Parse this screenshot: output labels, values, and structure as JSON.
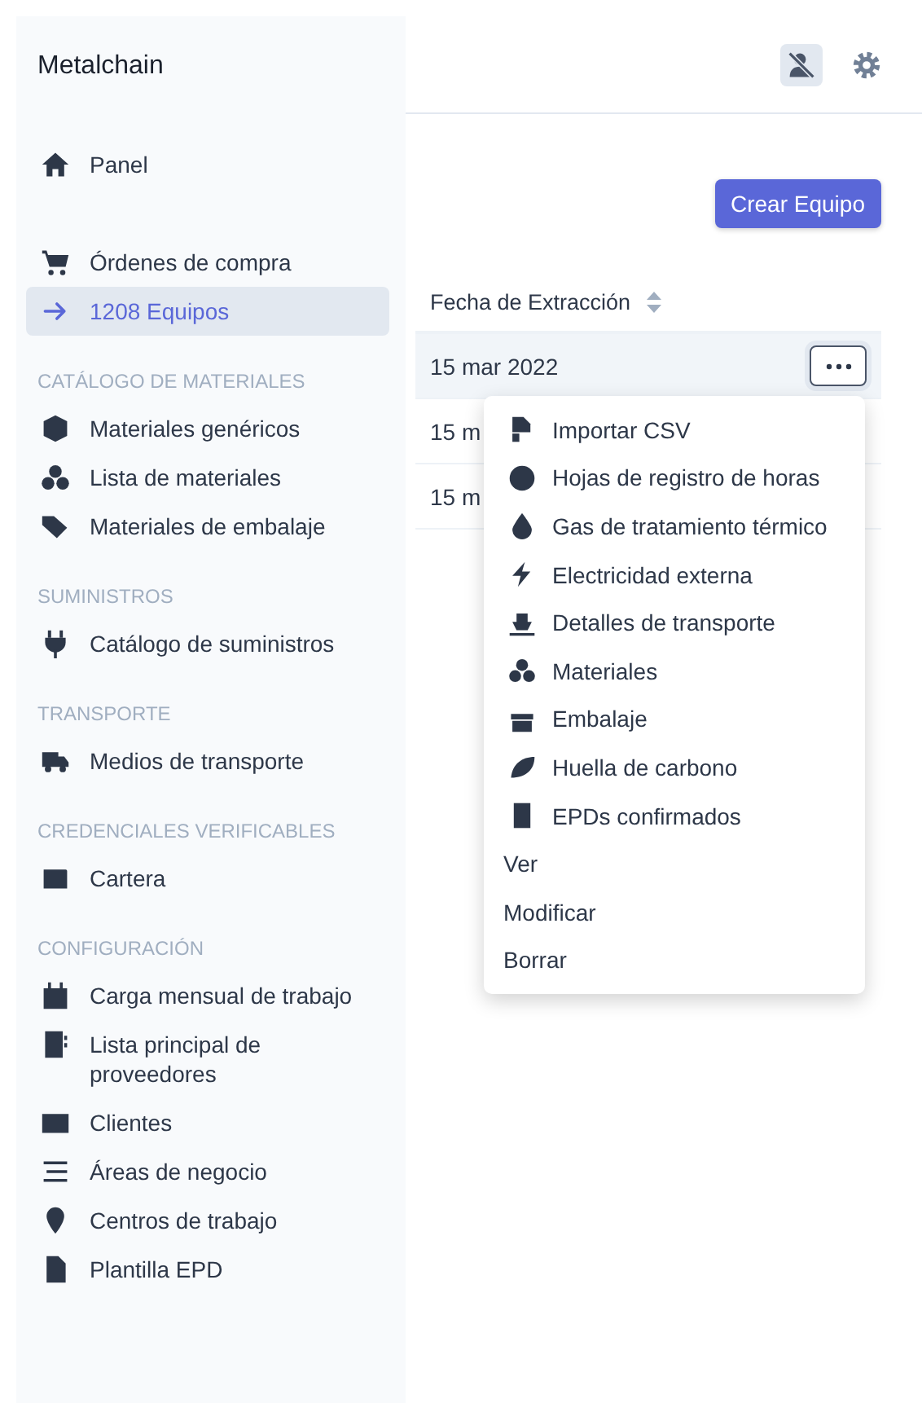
{
  "sidebar": {
    "brand": "Metalchain",
    "sections": [
      {
        "items": [
          {
            "label": "Panel",
            "selected": false
          }
        ]
      },
      {
        "items": [
          {
            "label": "Órdenes de compra",
            "selected": false
          },
          {
            "label": "1208 Equipos",
            "selected": true
          }
        ]
      },
      {
        "heading": "CATÁLOGO DE MATERIALES",
        "items": [
          {
            "label": "Materiales genéricos",
            "selected": false
          },
          {
            "label": "Lista de materiales",
            "selected": false
          },
          {
            "label": "Materiales de embalaje",
            "selected": false
          }
        ]
      },
      {
        "heading": "SUMINISTROS",
        "items": [
          {
            "label": "Catálogo de suministros",
            "selected": false
          }
        ]
      },
      {
        "heading": "TRANSPORTE",
        "items": [
          {
            "label": "Medios de transporte",
            "selected": false
          }
        ]
      },
      {
        "heading": "CREDENCIALES VERIFICABLES",
        "items": [
          {
            "label": "Cartera",
            "selected": false
          }
        ]
      },
      {
        "heading": "CONFIGURACIÓN",
        "items": [
          {
            "label": "Carga mensual de trabajo",
            "selected": false
          },
          {
            "label": "Lista principal de proveedores",
            "selected": false
          },
          {
            "label": "Clientes",
            "selected": false
          },
          {
            "label": "Áreas de negocio",
            "selected": false
          },
          {
            "label": "Centros de trabajo",
            "selected": false
          },
          {
            "label": "Plantilla EPD",
            "selected": false
          }
        ]
      }
    ]
  },
  "header": {
    "user_toggle": {
      "on": true
    }
  },
  "create_button": "Crear Equipo",
  "table": {
    "columns": [
      "Fecha de Extracción"
    ],
    "rows": [
      {
        "cells": [
          "15 mar 2022"
        ],
        "hovered": true
      },
      {
        "cells": [
          "15 m"
        ],
        "hovered": false
      },
      {
        "cells": [
          "15 m"
        ],
        "hovered": false
      }
    ]
  },
  "row_menu": {
    "open": true,
    "items": [
      {
        "kind": "icon",
        "label": "Importar CSV"
      },
      {
        "kind": "icon",
        "label": "Hojas de registro de horas"
      },
      {
        "kind": "icon",
        "label": "Gas de tratamiento térmico"
      },
      {
        "kind": "icon",
        "label": "Electricidad externa"
      },
      {
        "kind": "icon",
        "label": "Detalles de transporte"
      },
      {
        "kind": "icon",
        "label": "Materiales"
      },
      {
        "kind": "icon",
        "label": "Embalaje"
      },
      {
        "kind": "icon",
        "label": "Huella de carbono"
      },
      {
        "kind": "icon",
        "label": "EPDs confirmados"
      },
      {
        "kind": "plain",
        "label": "Ver"
      },
      {
        "kind": "plain",
        "label": "Modificar"
      },
      {
        "kind": "plain",
        "label": "Borrar"
      }
    ]
  }
}
